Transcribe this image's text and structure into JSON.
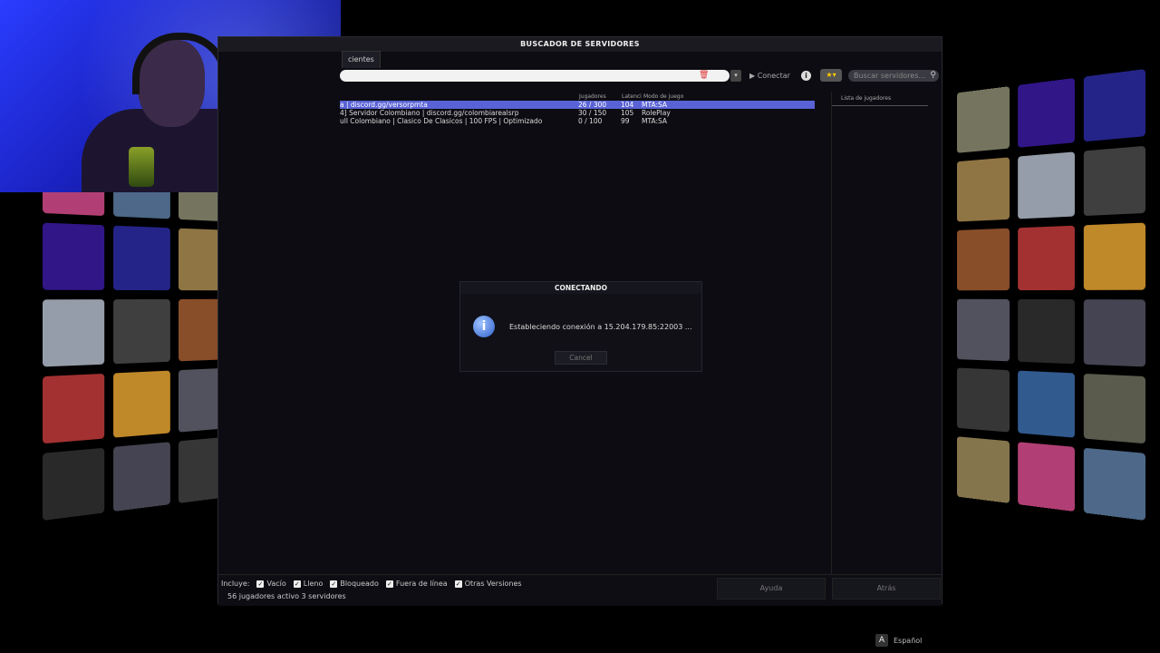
{
  "window": {
    "title": "BUSCADOR DE SERVIDORES",
    "tab_label": "cientes"
  },
  "toolbar": {
    "address_value": "",
    "connect_label": "Conectar",
    "info_icon": "info-icon",
    "search_placeholder": "Buscar servidores..."
  },
  "server_list": {
    "headers": {
      "players": "Jugadores",
      "latency": "Latenci",
      "gamemode": "Modo de juego"
    },
    "rows": [
      {
        "name": "a | discord.gg/versorpmta",
        "players": "26 / 300",
        "latency": "104",
        "gamemode": "MTA:SA",
        "selected": true
      },
      {
        "name": "4] Servidor Colombiano | discord.gg/colombiarealsrp",
        "players": "30 / 150",
        "latency": "105",
        "gamemode": "RolePlay",
        "selected": false
      },
      {
        "name": "ull Colombiano | Clasico De Clasicos | 100 FPS | Optimizado",
        "players": "0 / 100",
        "latency": "99",
        "gamemode": "MTA:SA",
        "selected": false
      }
    ]
  },
  "players_panel": {
    "header": "Lista de jugadores"
  },
  "footer": {
    "includes_label": "Incluye:",
    "filters": [
      {
        "label": "Vacío",
        "checked": true
      },
      {
        "label": "Lleno",
        "checked": true
      },
      {
        "label": "Bloqueado",
        "checked": true
      },
      {
        "label": "Fuera de línea",
        "checked": true
      },
      {
        "label": "Otras Versiones",
        "checked": true
      }
    ],
    "status": "56 jugadores activo 3 servidores",
    "help_label": "Ayuda",
    "back_label": "Atrás"
  },
  "dialog": {
    "title": "CONECTANDO",
    "message": "Estableciendo conexión a 15.204.179.85:22003 ...",
    "cancel_label": "Cancel"
  },
  "language": {
    "label": "Español"
  },
  "colors": {
    "selection": "#5a63d6",
    "window_bg": "#0c0c12",
    "webcam_blue": "#2a3cff"
  }
}
